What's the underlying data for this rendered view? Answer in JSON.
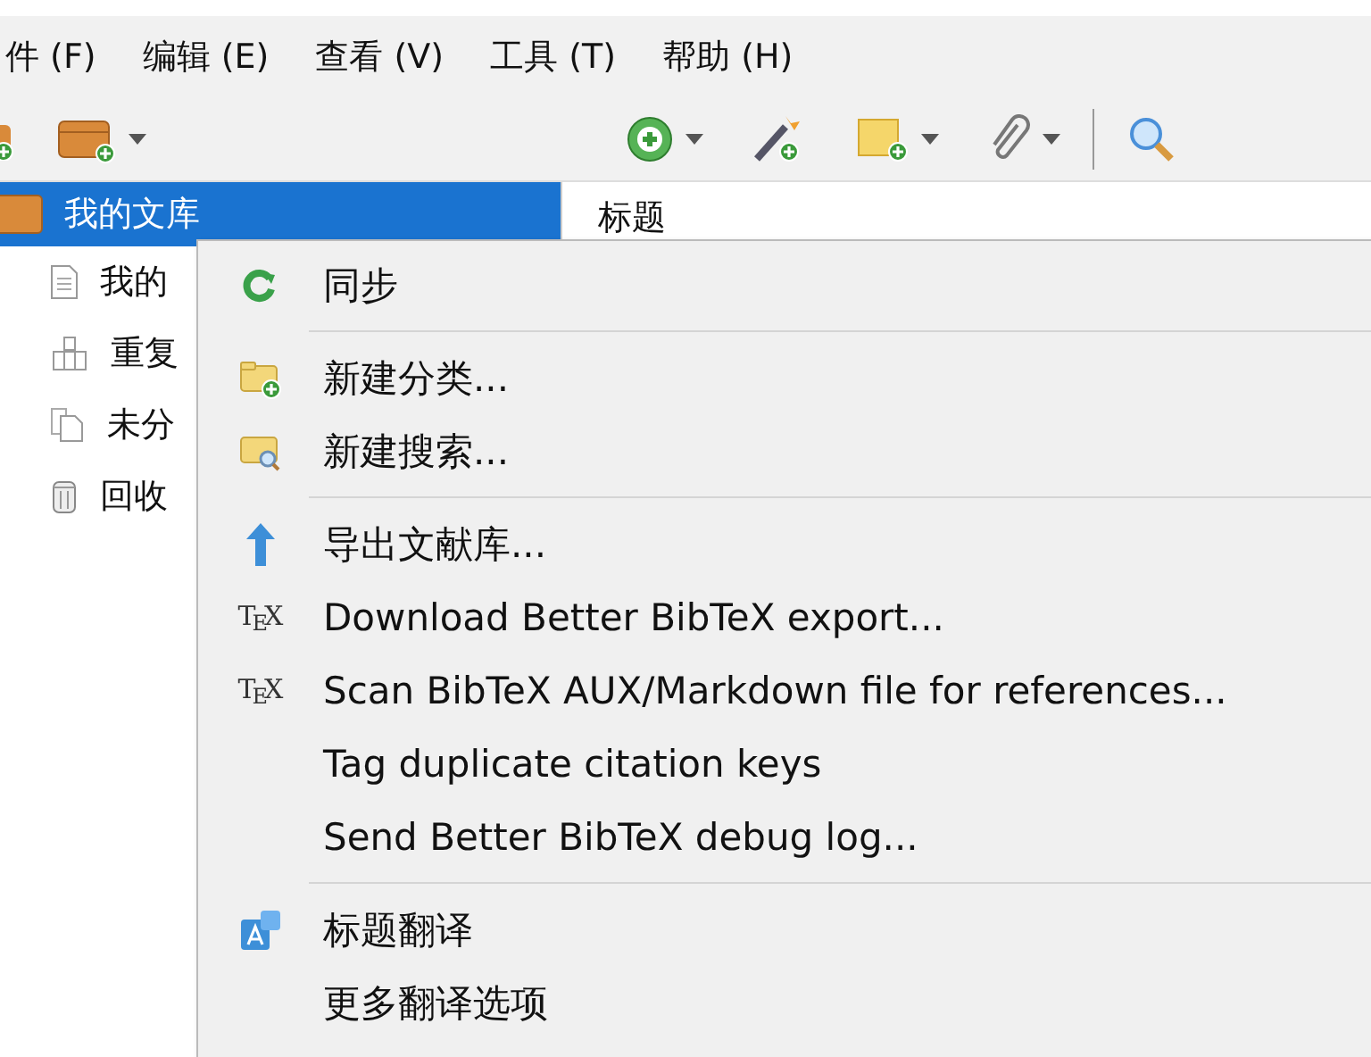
{
  "menubar": [
    {
      "label": "件 (F)"
    },
    {
      "label": "编辑 (E)"
    },
    {
      "label": "查看 (V)"
    },
    {
      "label": "工具 (T)"
    },
    {
      "label": "帮助 (H)"
    }
  ],
  "tree": [
    {
      "label": "我的文库",
      "selected": true,
      "children": [
        {
          "label": "我的",
          "selected": false
        },
        {
          "label": "重复",
          "selected": false
        },
        {
          "label": "未分",
          "selected": false
        },
        {
          "label": "回收",
          "selected": false
        }
      ]
    }
  ],
  "items_header": {
    "column_1": "标题"
  },
  "context_menu": [
    {
      "kind": "item",
      "label": "同步"
    },
    {
      "kind": "separator"
    },
    {
      "kind": "item",
      "label": "新建分类..."
    },
    {
      "kind": "item",
      "label": "新建搜索..."
    },
    {
      "kind": "separator"
    },
    {
      "kind": "item",
      "label": "导出文献库..."
    },
    {
      "kind": "item",
      "label": "Download Better BibTeX export...",
      "icon_text": "T$_{E}$X"
    },
    {
      "kind": "item",
      "label": "Scan BibTeX AUX/Markdown file for references...",
      "icon_text": "T$_{E}$X"
    },
    {
      "kind": "item",
      "label": "Tag duplicate citation keys"
    },
    {
      "kind": "item",
      "label": "Send Better BibTeX debug log..."
    },
    {
      "kind": "separator"
    },
    {
      "kind": "item",
      "label": "标题翻译"
    },
    {
      "kind": "item",
      "label": "更多翻译选项"
    }
  ]
}
